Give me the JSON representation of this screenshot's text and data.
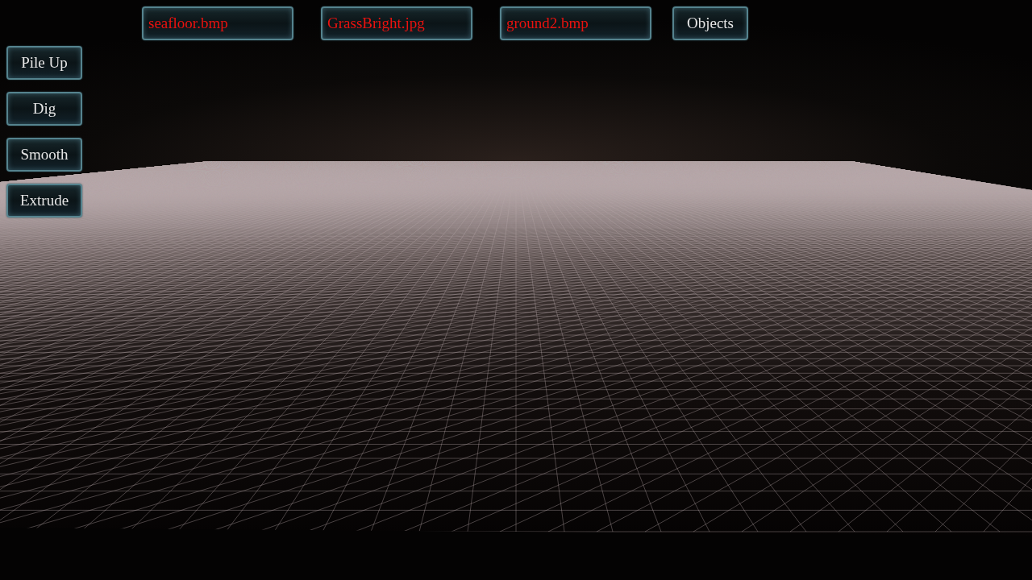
{
  "textures": [
    {
      "label": "seafloor.bmp"
    },
    {
      "label": "GrassBright.jpg"
    },
    {
      "label": "ground2.bmp"
    }
  ],
  "objects_button": {
    "label": "Objects"
  },
  "tools": [
    {
      "label": "Pile Up"
    },
    {
      "label": "Dig"
    },
    {
      "label": "Smooth"
    },
    {
      "label": "Extrude"
    }
  ]
}
